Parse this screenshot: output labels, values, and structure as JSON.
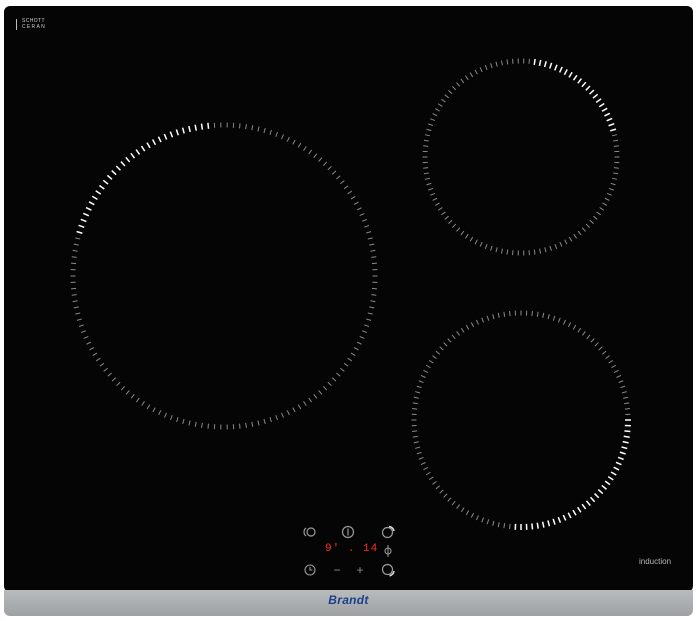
{
  "hob": {
    "glass_logo": {
      "line1": "SCHOTT",
      "line2": "CERAN"
    },
    "type_label": "induction",
    "brand": "Brandt",
    "colors": {
      "glass": "#050505",
      "frame": "#a9acae",
      "brand": "#1c3f8c",
      "display_red": "#ff2a1a",
      "zone_marks": "#ffffff"
    }
  },
  "zones": [
    {
      "name": "large-left",
      "highlight": "upper-left arc"
    },
    {
      "name": "small-top-right",
      "highlight": "upper-right arc"
    },
    {
      "name": "medium-bottom-right",
      "highlight": "lower-right arc"
    }
  ],
  "controls": {
    "display": {
      "zone_level": "9",
      "separator": "'",
      "dot": ".",
      "minutes": "14"
    },
    "icons": [
      "bridge-zone-icon",
      "power-icon",
      "zone-select-icon",
      "zone-select-icon",
      "timer-icon",
      "zone-select-icon"
    ],
    "minus_label": "−",
    "plus_label": "+"
  }
}
